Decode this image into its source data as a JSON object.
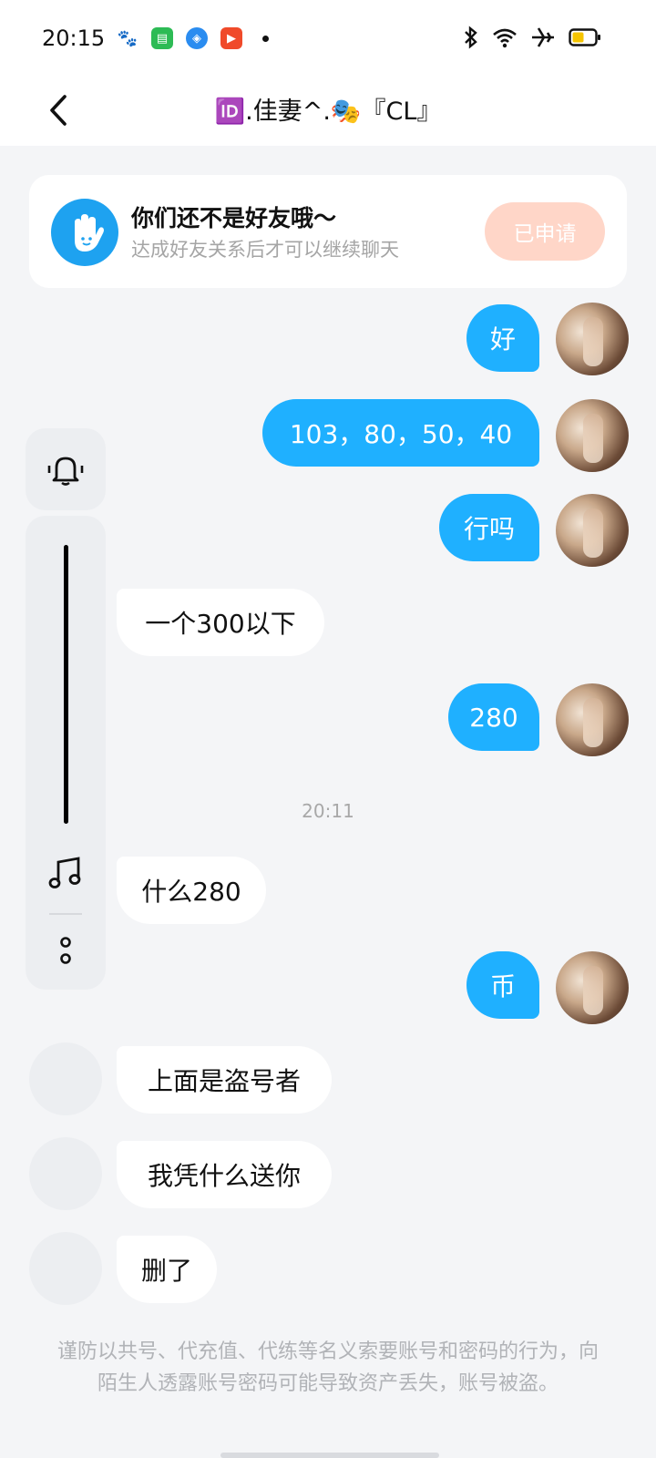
{
  "status_bar": {
    "time": "20:15",
    "battery_color": "#f5c400"
  },
  "header": {
    "title": "🆔.佳妻^.🎭『CL』"
  },
  "friend_prompt": {
    "title": "你们还不是好友哦～",
    "subtitle": "达成好友关系后才可以继续聊天",
    "button_label": "已申请"
  },
  "messages": [
    {
      "side": "me",
      "text": "好"
    },
    {
      "side": "me",
      "text": "103，80，50，40"
    },
    {
      "side": "me",
      "text": "行吗"
    },
    {
      "side": "other",
      "text": "一个300以下"
    },
    {
      "side": "me",
      "text": "280"
    },
    {
      "side": "other",
      "text": "什么280"
    },
    {
      "side": "me",
      "text": "币"
    },
    {
      "side": "other",
      "text": "上面是盗号者"
    },
    {
      "side": "other",
      "text": "我凭什么送你"
    },
    {
      "side": "other",
      "text": "删了"
    }
  ],
  "timestamp": "20:11",
  "disclaimer": "谨防以共号、代充值、代练等名义索要账号和密码的行为，向陌生人透露账号密码可能导致资产丢失，账号被盗。",
  "colors": {
    "my_bubble": "#1fb0ff",
    "accent": "#1ea2f0",
    "apply_button": "#ffd6c8"
  }
}
